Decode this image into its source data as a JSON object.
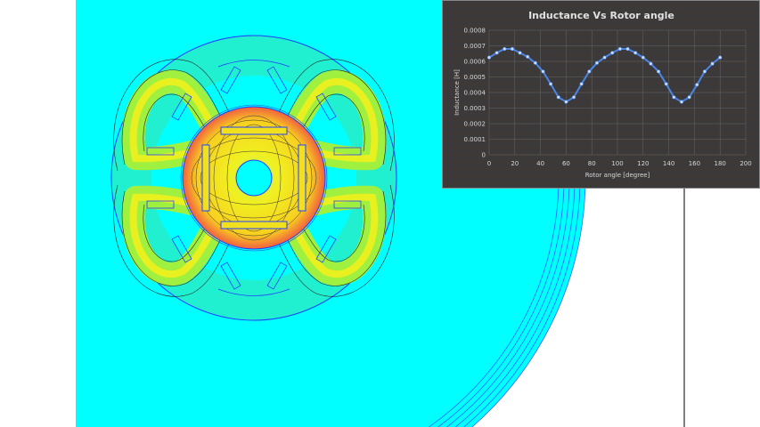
{
  "simulation": {
    "view": "magnetic-flux-density-plot"
  },
  "chart_data": {
    "type": "line",
    "title": "Inductance Vs Rotor angle",
    "xlabel": "Rotor angle [degree]",
    "ylabel": "Inductance [H]",
    "xlim": [
      0,
      200
    ],
    "ylim": [
      0,
      0.0008
    ],
    "xticks": [
      "0",
      "20",
      "40",
      "60",
      "80",
      "100",
      "120",
      "140",
      "160",
      "180",
      "200"
    ],
    "yticks": [
      "0",
      "0.0001",
      "0.0002",
      "0.0003",
      "0.0004",
      "0.0005",
      "0.0006",
      "0.0007",
      "0.0008"
    ],
    "grid": true,
    "series": [
      {
        "name": "Inductance",
        "color": "#4a86e8",
        "x": [
          0,
          6,
          12,
          18,
          24,
          30,
          36,
          42,
          48,
          54,
          60,
          66,
          72,
          78,
          84,
          90,
          96,
          102,
          108,
          114,
          120,
          126,
          132,
          138,
          144,
          150,
          156,
          162,
          168,
          174,
          180
        ],
        "y": [
          0.000625,
          0.000655,
          0.00068,
          0.00068,
          0.000655,
          0.00063,
          0.00059,
          0.000535,
          0.000455,
          0.00037,
          0.00034,
          0.00037,
          0.000455,
          0.000535,
          0.00059,
          0.000625,
          0.000655,
          0.00068,
          0.00068,
          0.000655,
          0.000625,
          0.000585,
          0.000535,
          0.000455,
          0.00037,
          0.00034,
          0.00037,
          0.00045,
          0.000535,
          0.000585,
          0.000625
        ]
      }
    ]
  }
}
